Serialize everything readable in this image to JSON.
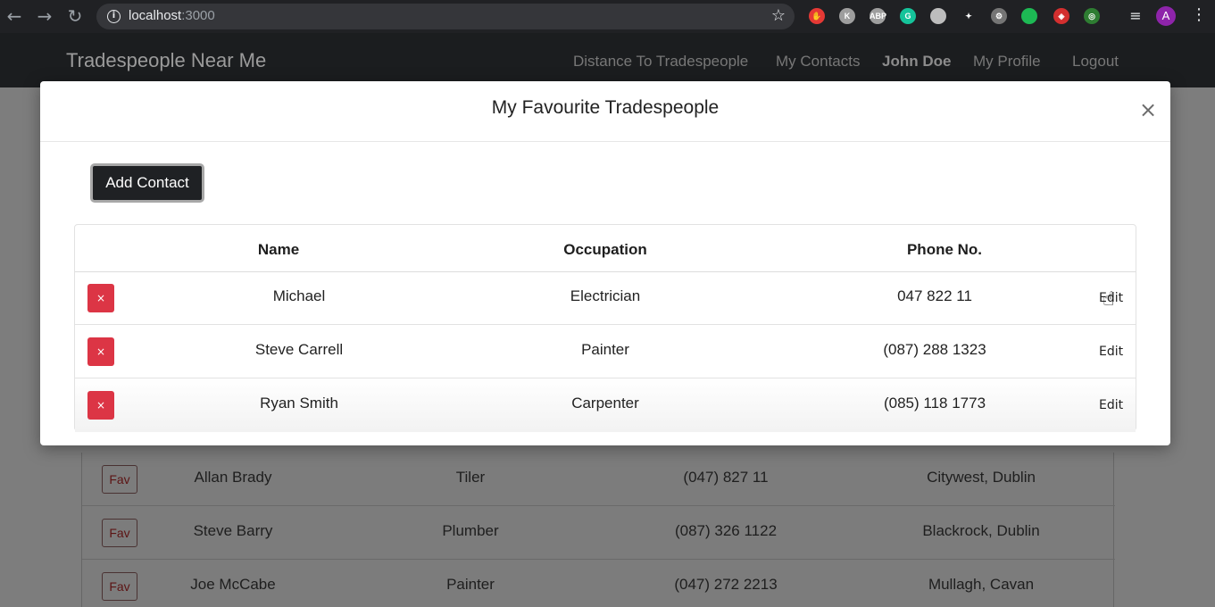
{
  "browser": {
    "url_host": "localhost",
    "url_port": ":3000",
    "avatar_letter": "A",
    "extensions": [
      {
        "name": "adblock-hand-icon",
        "color": "#e53935",
        "label": "✋"
      },
      {
        "name": "grey-extension-icon",
        "color": "#9e9e9e",
        "label": "K"
      },
      {
        "name": "abp-icon",
        "color": "#9e9e9e",
        "label": "ABP"
      },
      {
        "name": "grammarly-icon",
        "color": "#15c39a",
        "label": "G"
      },
      {
        "name": "docs-icon",
        "color": "#bdbdbd",
        "label": ""
      },
      {
        "name": "spark-icon",
        "color": "#202124",
        "label": "✦"
      },
      {
        "name": "gear-extension-icon",
        "color": "#757575",
        "label": "⚙"
      },
      {
        "name": "chat-bubble-icon",
        "color": "#1db954",
        "label": ""
      },
      {
        "name": "red-extension-icon",
        "color": "#d32f2f",
        "label": "◈"
      },
      {
        "name": "target-icon",
        "color": "#2e7d32",
        "label": "◎"
      }
    ]
  },
  "navbar": {
    "brand": "Tradespeople Near Me",
    "links": {
      "distance": "Distance To Tradespeople",
      "contacts": "My Contacts",
      "user": "John Doe",
      "profile": "My Profile",
      "logout": "Logout"
    }
  },
  "modal": {
    "title": "My Favourite Tradespeople",
    "close_symbol": "×",
    "add_button": "Add Contact",
    "columns": {
      "name": "Name",
      "occupation": "Occupation",
      "phone": "Phone No."
    },
    "delete_symbol": "×",
    "edit_label": "Edit",
    "rows": [
      {
        "name": "Michael",
        "occupation": "Electrician",
        "phone": "047 822 11"
      },
      {
        "name": "Steve Carrell",
        "occupation": "Painter",
        "phone": "(087) 288 1323"
      },
      {
        "name": "Ryan Smith",
        "occupation": "Carpenter",
        "phone": "(085) 118 1773"
      }
    ]
  },
  "background_table": {
    "fav_label": "Fav",
    "rows": [
      {
        "name": "Allan Brady",
        "occupation": "Tiler",
        "phone": "(047) 827 11",
        "location": "Citywest, Dublin"
      },
      {
        "name": "Steve Barry",
        "occupation": "Plumber",
        "phone": "(087) 326 1122",
        "location": "Blackrock, Dublin"
      },
      {
        "name": "Joe McCabe",
        "occupation": "Painter",
        "phone": "(047) 272 2213",
        "location": "Mullagh, Cavan"
      }
    ]
  }
}
